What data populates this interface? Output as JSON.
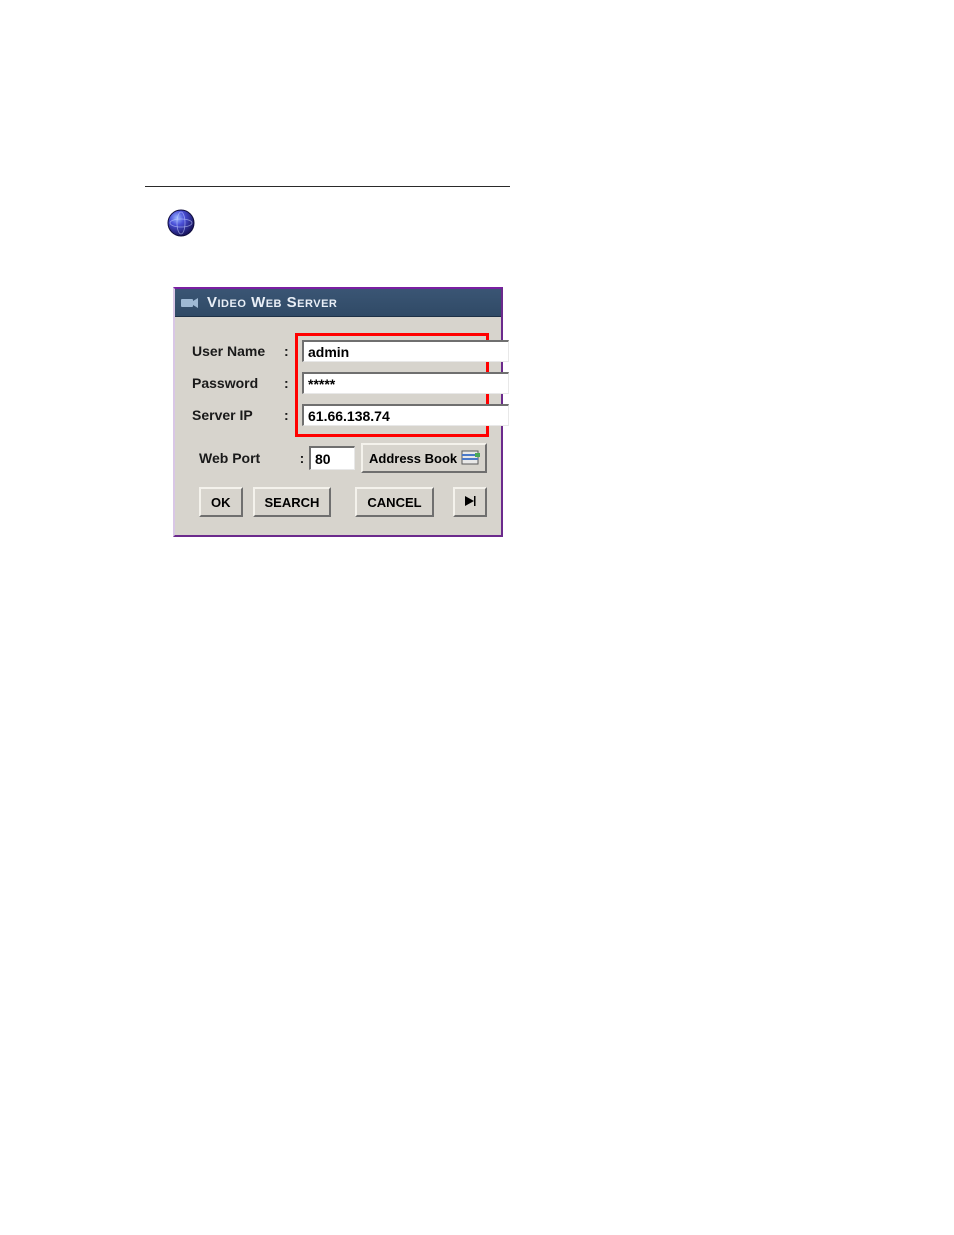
{
  "dialog": {
    "title": "Video Web Server",
    "fields": {
      "username": {
        "label": "User Name",
        "value": "admin"
      },
      "password": {
        "label": "Password",
        "value": "*****"
      },
      "server_ip": {
        "label": "Server IP",
        "value": "61.66.138.74"
      },
      "web_port": {
        "label": "Web Port",
        "value": "80"
      }
    },
    "buttons": {
      "address_book": "Address Book",
      "ok": "OK",
      "search": "SEARCH",
      "cancel": "CANCEL"
    },
    "colon": ":"
  }
}
